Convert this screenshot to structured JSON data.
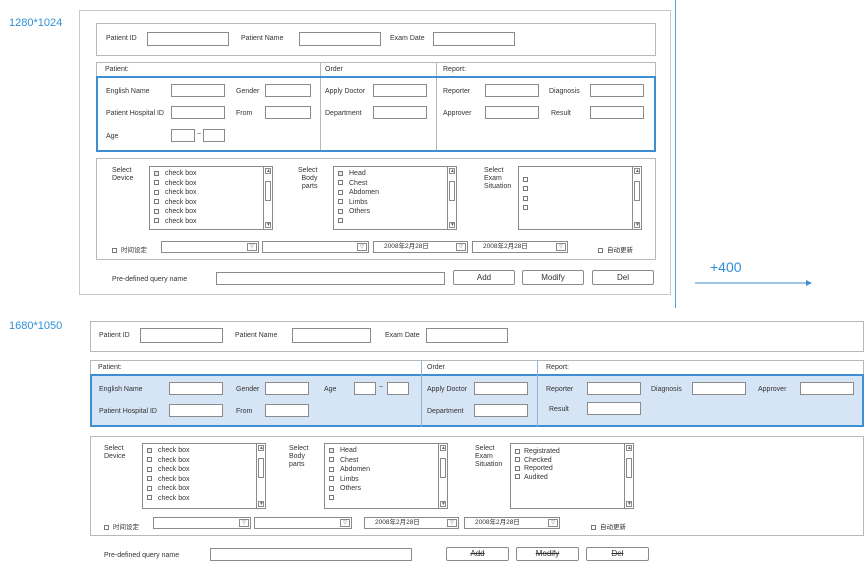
{
  "resolutions": {
    "first": "1280*1024",
    "second": "1680*1050",
    "delta": "+400"
  },
  "search": {
    "patient_id": "Patient ID",
    "patient_name": "Patient Name",
    "exam_date": "Exam Date"
  },
  "sections": {
    "patient": "Patient:",
    "order": "Order",
    "report": "Report:"
  },
  "patient": {
    "english_name": "English Name",
    "gender": "Gender",
    "hospital_id": "Patient Hospital ID",
    "from": "From",
    "age": "Age",
    "age_sep": "~"
  },
  "order": {
    "apply_doctor": "Apply Doctor",
    "department": "Department"
  },
  "report": {
    "reporter": "Reporter",
    "diagnosis": "Diagnosis",
    "approver": "Approver",
    "result": "Result"
  },
  "filters": {
    "select_device": "Select\nDevice",
    "select_body_parts": "Select\nBody\nparts",
    "select_exam_situation": "Select\nExam\nSituation",
    "device_items": [
      "check box",
      "check box",
      "check box",
      "check box",
      "check box",
      "check box"
    ],
    "body_parts": [
      "Head",
      "Chest",
      "Abdomen",
      "Limbs",
      "Others",
      ""
    ],
    "exam_situation_first": [
      "",
      "",
      "",
      ""
    ],
    "exam_situation_second": [
      "Registrated",
      "Checked",
      "Reported",
      "Audited"
    ]
  },
  "time_row": {
    "time_setting": "时间设定",
    "date_from": "2008年2月28日",
    "date_to": "2008年2月28日",
    "auto_update": "自动更新"
  },
  "query": {
    "predefined_label": "Pre-defined query name",
    "add": "Add",
    "modify": "Modify",
    "del": "Del"
  },
  "colors": {
    "accent_blue": "#3e8fd1",
    "highlight_fill": "#d6e5f6"
  }
}
